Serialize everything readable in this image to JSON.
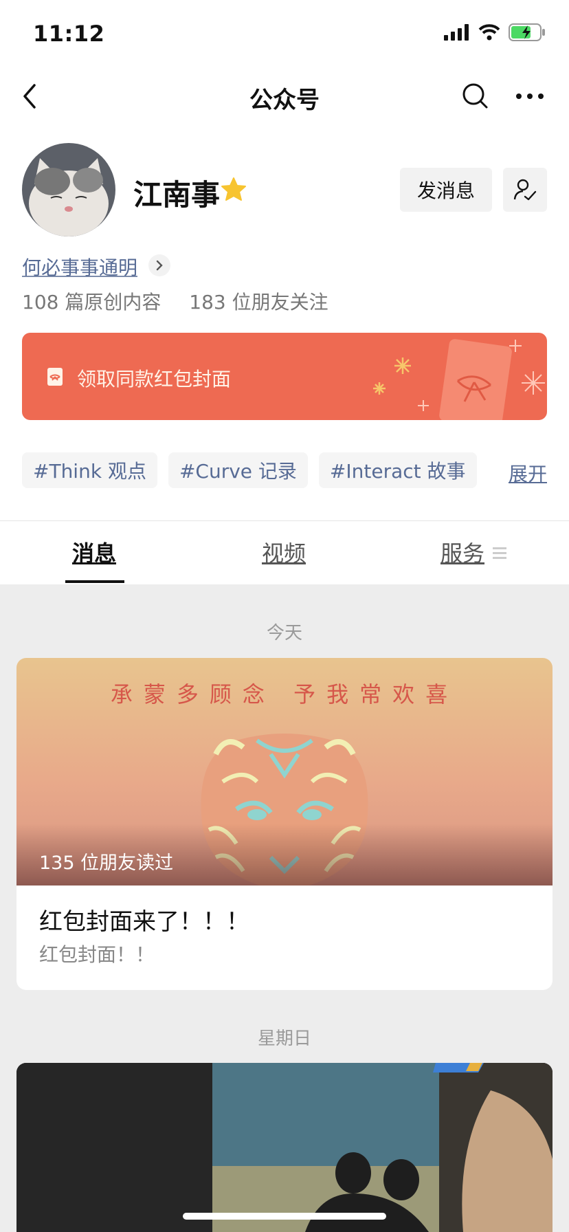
{
  "status_bar": {
    "time": "11:12"
  },
  "nav": {
    "title": "公众号"
  },
  "profile": {
    "name": "江南事",
    "send_message": "发消息",
    "slogan": "何必事事通明",
    "stats": [
      "108 篇原创内容",
      "183 位朋友关注"
    ]
  },
  "banner": {
    "text": "领取同款红包封面"
  },
  "tags": [
    "#Think 观点",
    "#Curve 记录",
    "#Interact 故事"
  ],
  "expand_label": "展开",
  "tabs": [
    "消息",
    "视频",
    "服务"
  ],
  "feed": [
    {
      "day": "今天",
      "cover_text": "承蒙多顾念  予我常欢喜",
      "read_count": "135 位朋友读过",
      "title": "红包封面来了！！！",
      "digest": "红包封面！！"
    },
    {
      "day": "星期日"
    }
  ],
  "colors": {
    "accent_red": "#ee6a52",
    "link_blue": "#576b95",
    "star": "#f7c430"
  }
}
